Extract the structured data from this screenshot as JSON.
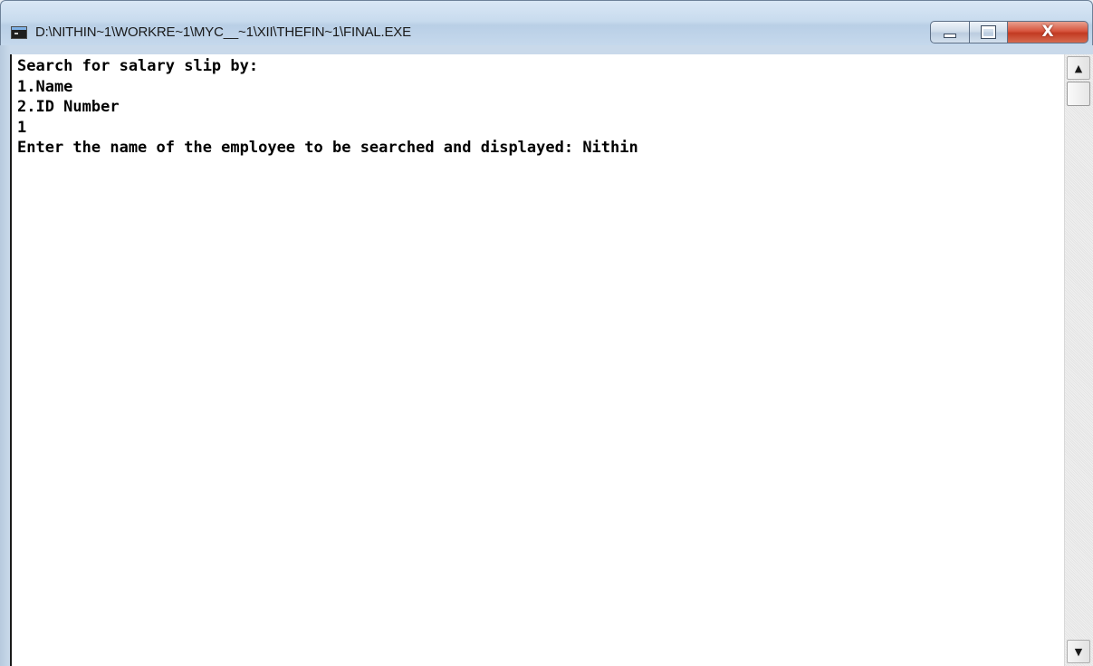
{
  "window": {
    "title": "D:\\NITHIN~1\\WORKRE~1\\MYC__~1\\XII\\THEFIN~1\\FINAL.EXE",
    "icon": "console-app-icon",
    "controls": {
      "minimize_icon": "minimize-icon",
      "maximize_icon": "maximize-icon",
      "close_icon": "close-icon",
      "close_glyph": "X"
    }
  },
  "console": {
    "lines": [
      "Search for salary slip by:",
      "1.Name",
      "2.ID Number",
      "1",
      "Enter the name of the employee to be searched and displayed: Nithin"
    ]
  },
  "scrollbar": {
    "up_arrow": "▲",
    "down_arrow": "▼"
  },
  "colors": {
    "close_button": "#c23a22",
    "console_background": "#ffffff",
    "console_text": "#000000",
    "titlebar": "#c8dbee"
  }
}
